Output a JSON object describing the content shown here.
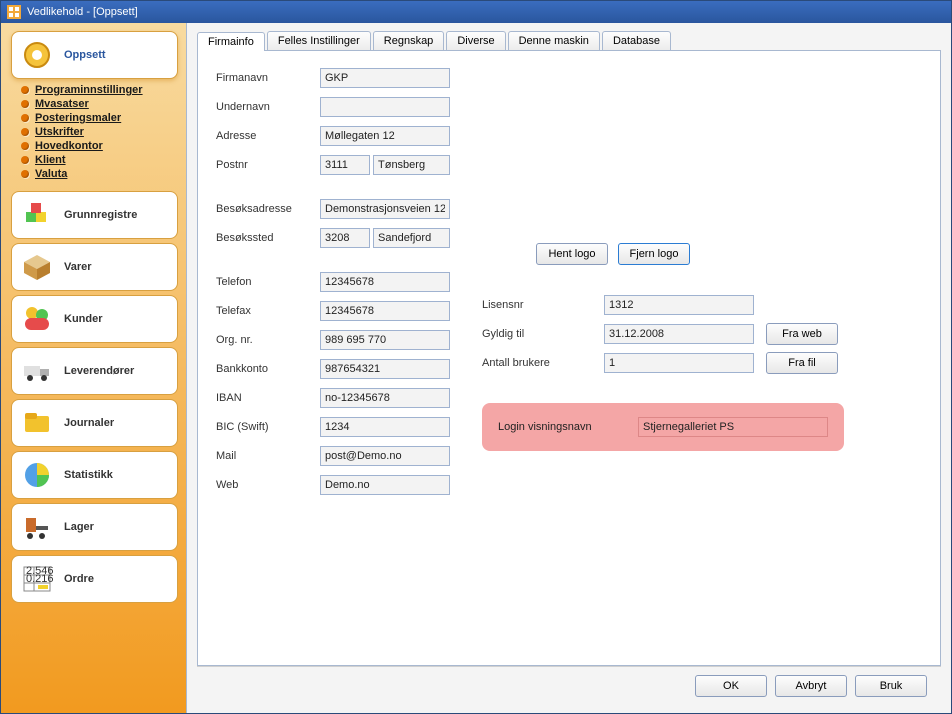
{
  "window": {
    "title": "Vedlikehold - [Oppsett]"
  },
  "sidebar": {
    "active": {
      "label": "Oppsett"
    },
    "submenu": [
      {
        "label": "Programinnstillinger"
      },
      {
        "label": "Mvasatser"
      },
      {
        "label": "Posteringsmaler"
      },
      {
        "label": "Utskrifter"
      },
      {
        "label": "Hovedkontor"
      },
      {
        "label": "Klient"
      },
      {
        "label": "Valuta"
      }
    ],
    "items": [
      {
        "label": "Grunnregistre"
      },
      {
        "label": "Varer"
      },
      {
        "label": "Kunder"
      },
      {
        "label": "Leverendører"
      },
      {
        "label": "Journaler"
      },
      {
        "label": "Statistikk"
      },
      {
        "label": "Lager"
      },
      {
        "label": "Ordre"
      }
    ]
  },
  "tabs": [
    {
      "label": "Firmainfo"
    },
    {
      "label": "Felles Instillinger"
    },
    {
      "label": "Regnskap"
    },
    {
      "label": "Diverse"
    },
    {
      "label": "Denne maskin"
    },
    {
      "label": "Database"
    }
  ],
  "form": {
    "labels": {
      "firmanavn": "Firmanavn",
      "undernavn": "Undernavn",
      "adresse": "Adresse",
      "postnr": "Postnr",
      "besoksadresse": "Besøksadresse",
      "besokssted": "Besøkssted",
      "telefon": "Telefon",
      "telefax": "Telefax",
      "orgnr": "Org. nr.",
      "bankkonto": "Bankkonto",
      "iban": "IBAN",
      "bic": "BIC (Swift)",
      "mail": "Mail",
      "web": "Web",
      "lisensnr": "Lisensnr",
      "gyldigtil": "Gyldig til",
      "antallbrukere": "Antall brukere",
      "loginvisningsnavn": "Login visningsnavn"
    },
    "values": {
      "firmanavn": "GKP",
      "undernavn": "",
      "adresse": "Møllegaten 12",
      "postnr": "3111",
      "poststed": "Tønsberg",
      "besoksadresse": "Demonstrasjonsveien 12",
      "besokpostnr": "3208",
      "besokpoststed": "Sandefjord",
      "telefon": "12345678",
      "telefax": "12345678",
      "orgnr": "989 695 770",
      "bankkonto": "987654321",
      "iban": "no-12345678",
      "bic": "1234",
      "mail": "post@Demo.no",
      "web": "Demo.no",
      "lisensnr": "1312",
      "gyldigtil": "31.12.2008",
      "antallbrukere": "1",
      "loginvisningsnavn": "Stjernegalleriet PS"
    }
  },
  "buttons": {
    "hent_logo": "Hent logo",
    "fjern_logo": "Fjern logo",
    "fra_web": "Fra web",
    "fra_fil": "Fra fil",
    "ok": "OK",
    "avbryt": "Avbryt",
    "bruk": "Bruk"
  }
}
